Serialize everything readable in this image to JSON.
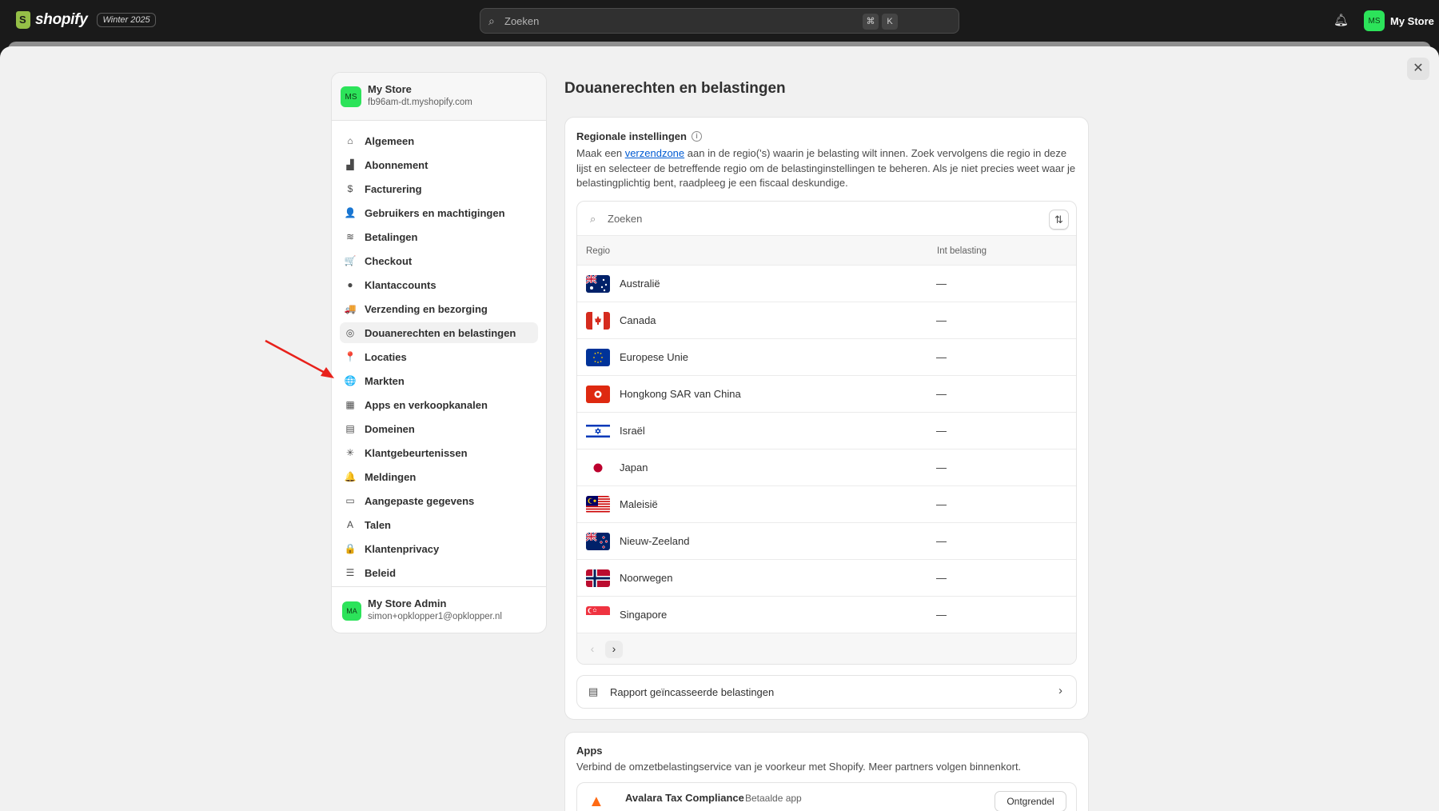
{
  "topbar": {
    "brand": "shopify",
    "edition": "Winter 2025",
    "search_placeholder": "Zoeken",
    "shortcut_keys": [
      "⌘",
      "K"
    ],
    "user_initials": "MS",
    "user_name": "My Store"
  },
  "nav": {
    "store_initials": "MS",
    "store_name": "My Store",
    "store_url": "fb96am-dt.myshopify.com",
    "items": [
      {
        "label": "Algemeen",
        "icon": "store-icon",
        "glyph": "⌂"
      },
      {
        "label": "Abonnement",
        "icon": "plan-icon",
        "glyph": "▟"
      },
      {
        "label": "Facturering",
        "icon": "billing-icon",
        "glyph": "$"
      },
      {
        "label": "Gebruikers en machtigingen",
        "icon": "users-icon",
        "glyph": "👤"
      },
      {
        "label": "Betalingen",
        "icon": "payments-icon",
        "glyph": "≋"
      },
      {
        "label": "Checkout",
        "icon": "cart-icon",
        "glyph": "🛒"
      },
      {
        "label": "Klantaccounts",
        "icon": "person-icon",
        "glyph": "●"
      },
      {
        "label": "Verzending en bezorging",
        "icon": "truck-icon",
        "glyph": "🚚"
      },
      {
        "label": "Douanerechten en belastingen",
        "icon": "tax-icon",
        "glyph": "◎"
      },
      {
        "label": "Locaties",
        "icon": "location-icon",
        "glyph": "📍"
      },
      {
        "label": "Markten",
        "icon": "globe-icon",
        "glyph": "🌐"
      },
      {
        "label": "Apps en verkoopkanalen",
        "icon": "apps-icon",
        "glyph": "▦"
      },
      {
        "label": "Domeinen",
        "icon": "domain-icon",
        "glyph": "▤"
      },
      {
        "label": "Klantgebeurtenissen",
        "icon": "cursor-icon",
        "glyph": "✳"
      },
      {
        "label": "Meldingen",
        "icon": "bell-icon",
        "glyph": "🔔"
      },
      {
        "label": "Aangepaste gegevens",
        "icon": "metafields-icon",
        "glyph": "▭"
      },
      {
        "label": "Talen",
        "icon": "language-icon",
        "glyph": "A"
      },
      {
        "label": "Klantenprivacy",
        "icon": "lock-icon",
        "glyph": "🔒"
      },
      {
        "label": "Beleid",
        "icon": "policy-icon",
        "glyph": "☰"
      }
    ],
    "active_index": 8,
    "admin_initials": "MA",
    "admin_name": "My Store Admin",
    "admin_email": "simon+opklopper1@opklopper.nl"
  },
  "main": {
    "title": "Douanerechten en belastingen",
    "regional": {
      "heading": "Regionale instellingen",
      "desc_before": "Maak een ",
      "desc_link": "verzendzone",
      "desc_after": " aan in de regio('s) waarin je belasting wilt innen. Zoek vervolgens die regio in deze lijst en selecteer de betreffende regio om de belastinginstellingen te beheren. Als je niet precies weet waar je belastingplichtig bent, raadpleeg je een fiscaal deskundige.",
      "search_placeholder": "Zoeken",
      "col_region": "Regio",
      "col_tax": "Int belasting",
      "rows": [
        {
          "name": "Australië",
          "tax": "—",
          "flag": "au"
        },
        {
          "name": "Canada",
          "tax": "—",
          "flag": "ca"
        },
        {
          "name": "Europese Unie",
          "tax": "—",
          "flag": "eu"
        },
        {
          "name": "Hongkong SAR van China",
          "tax": "—",
          "flag": "hk"
        },
        {
          "name": "Israël",
          "tax": "—",
          "flag": "il"
        },
        {
          "name": "Japan",
          "tax": "—",
          "flag": "jp"
        },
        {
          "name": "Maleisië",
          "tax": "—",
          "flag": "my"
        },
        {
          "name": "Nieuw-Zeeland",
          "tax": "—",
          "flag": "nz"
        },
        {
          "name": "Noorwegen",
          "tax": "—",
          "flag": "no"
        },
        {
          "name": "Singapore",
          "tax": "—",
          "flag": "sg"
        }
      ],
      "report_label": "Rapport geïncasseerde belastingen"
    },
    "apps": {
      "heading": "Apps",
      "desc": "Verbind de omzetbelastingservice van je voorkeur met Shopify. Meer partners volgen binnenkort.",
      "app_name": "Avalara Tax Compliance",
      "app_badge": "Betaalde app",
      "app_button": "Ontgrendel"
    }
  },
  "colors": {
    "accent_green": "#2ce35a",
    "link": "#005bd3",
    "annotation": "#e8211b"
  }
}
